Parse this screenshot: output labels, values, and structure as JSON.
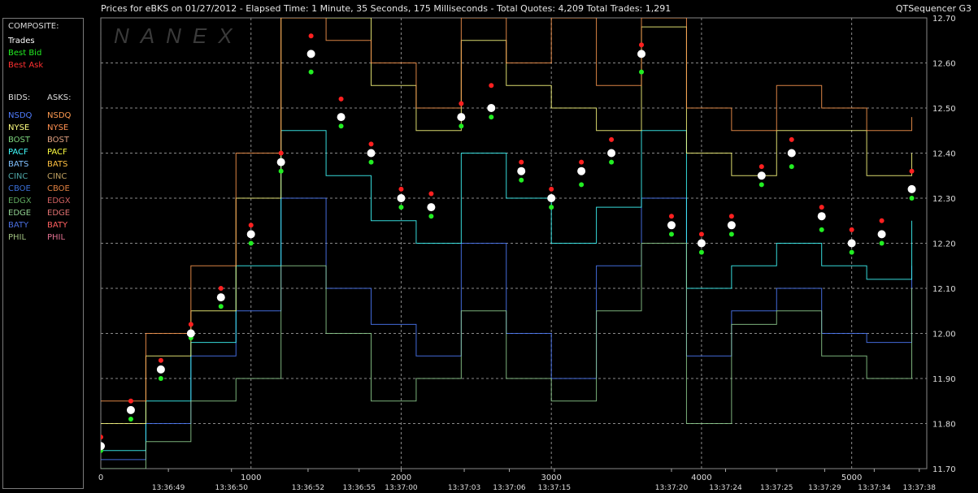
{
  "header": {
    "title": "Prices for  eBKS  on  01/27/2012  -  Elapsed Time: 1 Minute, 35 Seconds, 175 Milliseconds  -  Total Quotes: 4,209  Total Trades: 1,291",
    "app_name": "QTSequencer G3",
    "watermark": "NANEX"
  },
  "legend": {
    "composite_title": "COMPOSITE:",
    "trades": "Trades",
    "best_bid": "Best Bid",
    "best_ask": "Best Ask",
    "bids_title": "BIDS:",
    "asks_title": "ASKS:",
    "exchanges": [
      {
        "bid": "NSDQ",
        "ask": "NSDQ",
        "bid_color": "#4f7cff",
        "ask_color": "#ff9a50"
      },
      {
        "bid": "NYSE",
        "ask": "NYSE",
        "bid_color": "#ffff80",
        "ask_color": "#ff9050"
      },
      {
        "bid": "BOST",
        "ask": "BOST",
        "bid_color": "#7ed67e",
        "ask_color": "#e0a080"
      },
      {
        "bid": "PACF",
        "ask": "PACF",
        "bid_color": "#40ffff",
        "ask_color": "#ffff40"
      },
      {
        "bid": "BATS",
        "ask": "BATS",
        "bid_color": "#80c0ff",
        "ask_color": "#ffc040"
      },
      {
        "bid": "CINC",
        "ask": "CINC",
        "bid_color": "#4fa8a8",
        "ask_color": "#c0a060"
      },
      {
        "bid": "CBOE",
        "ask": "CBOE",
        "bid_color": "#3a6fd8",
        "ask_color": "#e08040"
      },
      {
        "bid": "EDGX",
        "ask": "EDGX",
        "bid_color": "#5fa85f",
        "ask_color": "#d06060"
      },
      {
        "bid": "EDGE",
        "ask": "EDGE",
        "bid_color": "#90d090",
        "ask_color": "#e07070"
      },
      {
        "bid": "BATY",
        "ask": "BATY",
        "bid_color": "#4a6fe0",
        "ask_color": "#ff6060"
      },
      {
        "bid": "PHIL",
        "ask": "PHIL",
        "bid_color": "#a0c080",
        "ask_color": "#e07090"
      }
    ],
    "colors": {
      "trades": "#ffffff",
      "best_bid": "#22ee22",
      "best_ask": "#ff2020",
      "composite": "#dddddd"
    }
  },
  "chart_data": {
    "type": "scatter",
    "ylim": [
      11.7,
      12.7
    ],
    "xlim": [
      0,
      5500
    ],
    "grid": true,
    "yticks": [
      "12.70",
      "12.60",
      "12.50",
      "12.40",
      "12.30",
      "12.20",
      "12.10",
      "12.00",
      "11.90",
      "11.80",
      "11.70"
    ],
    "ytick_values": [
      12.7,
      12.6,
      12.5,
      12.4,
      12.3,
      12.2,
      12.1,
      12.0,
      11.9,
      11.8,
      11.7
    ],
    "xticks_num": [
      {
        "label": "0",
        "x": 0
      },
      {
        "label": "1000",
        "x": 1000
      },
      {
        "label": "2000",
        "x": 2000
      },
      {
        "label": "3000",
        "x": 3000
      },
      {
        "label": "4000",
        "x": 4000
      },
      {
        "label": "5000",
        "x": 5000
      }
    ],
    "xticks_time": [
      {
        "label": "13:36:49",
        "x": 450
      },
      {
        "label": "13:36:50",
        "x": 870
      },
      {
        "label": "13:36:52",
        "x": 1380
      },
      {
        "label": "13:36:55",
        "x": 1720
      },
      {
        "label": "13:37:00",
        "x": 2000
      },
      {
        "label": "13:37:03",
        "x": 2420
      },
      {
        "label": "13:37:06",
        "x": 2720
      },
      {
        "label": "13:37:15",
        "x": 3020
      },
      {
        "label": "13:37:20",
        "x": 3800
      },
      {
        "label": "13:37:24",
        "x": 4160
      },
      {
        "label": "13:37:25",
        "x": 4500
      },
      {
        "label": "13:37:29",
        "x": 4820
      },
      {
        "label": "13:37:34",
        "x": 5150
      },
      {
        "label": "13:37:38",
        "x": 5450
      }
    ],
    "series": [
      {
        "name": "Trades",
        "color": "#ffffff",
        "x": [
          0,
          200,
          400,
          600,
          800,
          1000,
          1200,
          1400,
          1600,
          1800,
          2000,
          2200,
          2400,
          2600,
          2800,
          3000,
          3200,
          3400,
          3600,
          3800,
          4000,
          4200,
          4400,
          4600,
          4800,
          5000,
          5200,
          5400
        ],
        "values": [
          11.75,
          11.83,
          11.92,
          12.0,
          12.08,
          12.22,
          12.38,
          12.62,
          12.48,
          12.4,
          12.3,
          12.28,
          12.48,
          12.5,
          12.36,
          12.3,
          12.36,
          12.4,
          12.62,
          12.24,
          12.2,
          12.24,
          12.35,
          12.4,
          12.26,
          12.2,
          12.22,
          12.32
        ]
      },
      {
        "name": "Best Bid",
        "color": "#22ee22",
        "x": [
          0,
          200,
          400,
          600,
          800,
          1000,
          1200,
          1400,
          1600,
          1800,
          2000,
          2200,
          2400,
          2600,
          2800,
          3000,
          3200,
          3400,
          3600,
          3800,
          4000,
          4200,
          4400,
          4600,
          4800,
          5000,
          5200,
          5400
        ],
        "values": [
          11.74,
          11.81,
          11.9,
          11.99,
          12.06,
          12.2,
          12.36,
          12.58,
          12.46,
          12.38,
          12.28,
          12.26,
          12.46,
          12.48,
          12.34,
          12.28,
          12.33,
          12.38,
          12.58,
          12.22,
          12.18,
          12.22,
          12.33,
          12.37,
          12.23,
          12.18,
          12.2,
          12.3
        ]
      },
      {
        "name": "Best Ask",
        "color": "#ff2020",
        "x": [
          0,
          200,
          400,
          600,
          800,
          1000,
          1200,
          1400,
          1600,
          1800,
          2000,
          2200,
          2400,
          2600,
          2800,
          3000,
          3200,
          3400,
          3600,
          3800,
          4000,
          4200,
          4400,
          4600,
          4800,
          5000,
          5200,
          5400
        ],
        "values": [
          11.77,
          11.85,
          11.94,
          12.02,
          12.1,
          12.24,
          12.4,
          12.66,
          12.52,
          12.42,
          12.32,
          12.31,
          12.51,
          12.55,
          12.38,
          12.32,
          12.38,
          12.43,
          12.64,
          12.26,
          12.22,
          12.26,
          12.37,
          12.43,
          12.28,
          12.23,
          12.25,
          12.36
        ]
      }
    ],
    "exchange_traces": [
      {
        "name": "NSDQ bid",
        "color": "#4f7cff",
        "x": [
          0,
          300,
          600,
          900,
          1200,
          1500,
          1800,
          2100,
          2400,
          2700,
          3000,
          3300,
          3600,
          3900,
          4200,
          4500,
          4800,
          5100,
          5400
        ],
        "values": [
          11.72,
          11.8,
          11.95,
          12.05,
          12.3,
          12.1,
          12.02,
          11.95,
          12.2,
          12.0,
          11.9,
          12.15,
          12.3,
          11.95,
          12.05,
          12.1,
          12.0,
          11.98,
          12.15
        ]
      },
      {
        "name": "PACF bid",
        "color": "#40ffff",
        "x": [
          0,
          300,
          600,
          900,
          1200,
          1500,
          1800,
          2100,
          2400,
          2700,
          3000,
          3300,
          3600,
          3900,
          4200,
          4500,
          4800,
          5100,
          5400
        ],
        "values": [
          11.74,
          11.85,
          11.98,
          12.15,
          12.45,
          12.35,
          12.25,
          12.2,
          12.4,
          12.3,
          12.2,
          12.28,
          12.45,
          12.1,
          12.15,
          12.2,
          12.15,
          12.12,
          12.25
        ]
      },
      {
        "name": "NYSE ask",
        "color": "#ffff80",
        "x": [
          0,
          300,
          600,
          900,
          1200,
          1500,
          1800,
          2100,
          2400,
          2700,
          3000,
          3300,
          3600,
          3900,
          4200,
          4500,
          4800,
          5100,
          5400
        ],
        "values": [
          11.8,
          11.95,
          12.05,
          12.3,
          12.7,
          12.7,
          12.55,
          12.45,
          12.65,
          12.55,
          12.5,
          12.45,
          12.68,
          12.4,
          12.35,
          12.45,
          12.45,
          12.35,
          12.4
        ]
      },
      {
        "name": "NSDQ ask",
        "color": "#ff9a50",
        "x": [
          0,
          300,
          600,
          900,
          1200,
          1500,
          1800,
          2100,
          2400,
          2700,
          3000,
          3300,
          3600,
          3900,
          4200,
          4500,
          4800,
          5100,
          5400
        ],
        "values": [
          11.85,
          12.0,
          12.15,
          12.4,
          12.7,
          12.65,
          12.6,
          12.5,
          12.7,
          12.6,
          12.7,
          12.55,
          12.7,
          12.5,
          12.45,
          12.55,
          12.5,
          12.45,
          12.48
        ]
      },
      {
        "name": "EDGE bid",
        "color": "#90d090",
        "x": [
          0,
          300,
          600,
          900,
          1200,
          1500,
          1800,
          2100,
          2400,
          2700,
          3000,
          3300,
          3600,
          3900,
          4200,
          4500,
          4800,
          5100,
          5400
        ],
        "values": [
          11.7,
          11.76,
          11.85,
          11.9,
          12.15,
          12.0,
          11.85,
          11.9,
          12.05,
          11.9,
          11.85,
          12.05,
          12.2,
          11.8,
          12.02,
          12.05,
          11.95,
          11.9,
          12.1
        ]
      }
    ]
  }
}
